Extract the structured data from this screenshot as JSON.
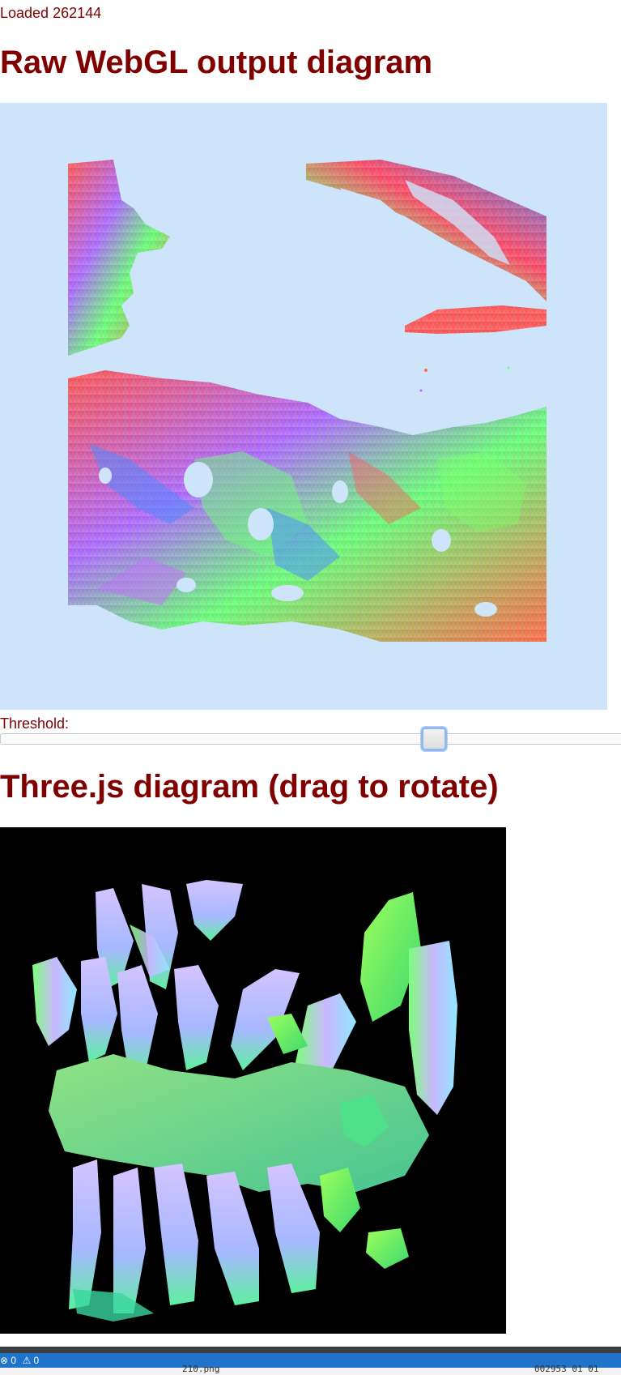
{
  "status": {
    "loaded_text": "Loaded 262144"
  },
  "raw_section": {
    "title": "Raw WebGL output diagram",
    "canvas_background": "#cde4fb"
  },
  "threshold": {
    "label": "Threshold:",
    "value_fraction": 0.7
  },
  "three_section": {
    "title": "Three.js diagram (drag to rotate)",
    "canvas_background": "#000000"
  },
  "editor_status_bar": {
    "errors_icon": "error-circle-icon",
    "errors_count": "0",
    "warnings_icon": "warning-triangle-icon",
    "warnings_count": "0",
    "file_name": "210.png",
    "position_text": "002953 01 01",
    "accent_color": "#1f73c9"
  }
}
